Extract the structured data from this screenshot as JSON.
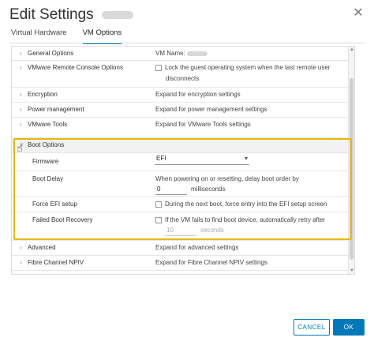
{
  "dialog": {
    "title": "Edit Settings",
    "close_icon": "close-icon"
  },
  "tabs": [
    {
      "label": "Virtual Hardware",
      "active": false
    },
    {
      "label": "VM Options",
      "active": true
    }
  ],
  "rows": {
    "general": {
      "label": "General Options",
      "value": "VM Name:"
    },
    "vmrc": {
      "label": "VMware Remote Console Options",
      "value_line1": "Lock the guest operating system when the last remote user",
      "value_line2": "disconnects"
    },
    "encryption": {
      "label": "Encryption",
      "value": "Expand for encryption settings"
    },
    "power": {
      "label": "Power management",
      "value": "Expand for power management settings"
    },
    "tools": {
      "label": "VMware Tools",
      "value": "Expand for VMware Tools settings"
    },
    "boot": {
      "label": "Boot Options"
    },
    "firmware": {
      "label": "Firmware",
      "value": "EFI"
    },
    "boot_delay": {
      "label": "Boot Delay",
      "desc": "When powering on or resetting, delay boot order by",
      "input_value": "0",
      "unit": "milliseconds"
    },
    "force_efi": {
      "label": "Force EFI setup",
      "value": "During the next boot, force entry into the EFI setup screen"
    },
    "failed_boot": {
      "label": "Failed Boot Recovery",
      "value": "If the VM fails to find boot device, automatically retry after",
      "input_value": "10",
      "unit": "seconds"
    },
    "advanced": {
      "label": "Advanced",
      "value": "Expand for advanced settings"
    },
    "fibre": {
      "label": "Fibre Channel NPIV",
      "value": "Expand for Fibre Channel NPIV settings"
    }
  },
  "footer": {
    "cancel_label": "CANCEL",
    "ok_label": "OK"
  },
  "colors": {
    "accent": "#0079b8",
    "highlight": "#e8b800"
  }
}
